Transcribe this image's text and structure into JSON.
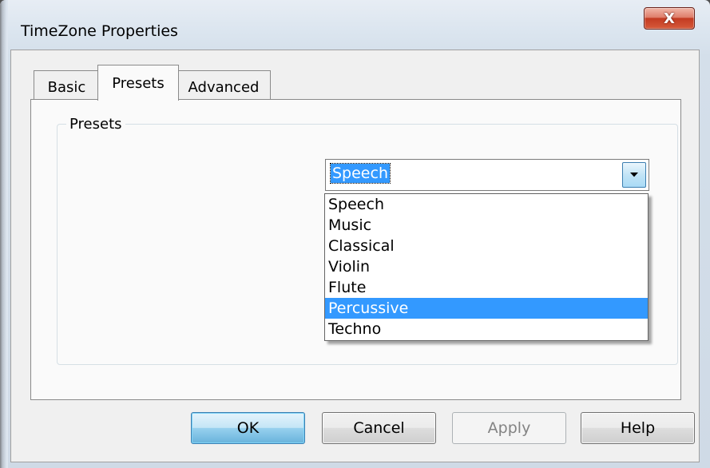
{
  "window": {
    "title": "TimeZone Properties",
    "close_label": "X"
  },
  "tabs": [
    {
      "label": "Basic",
      "selected": false
    },
    {
      "label": "Presets",
      "selected": true
    },
    {
      "label": "Advanced",
      "selected": false
    }
  ],
  "presets_group": {
    "legend": "Presets",
    "combo": {
      "value": "Speech",
      "options": [
        "Speech",
        "Music",
        "Classical",
        "Violin",
        "Flute",
        "Percussive",
        "Techno"
      ],
      "highlighted_option": "Percussive"
    }
  },
  "buttons": {
    "ok": "OK",
    "cancel": "Cancel",
    "apply": "Apply",
    "help": "Help"
  },
  "colors": {
    "selection": "#3399ff",
    "close_button": "#c33b22"
  },
  "icons": {
    "combo_arrow": "chevron-down-icon",
    "close": "close-icon"
  }
}
